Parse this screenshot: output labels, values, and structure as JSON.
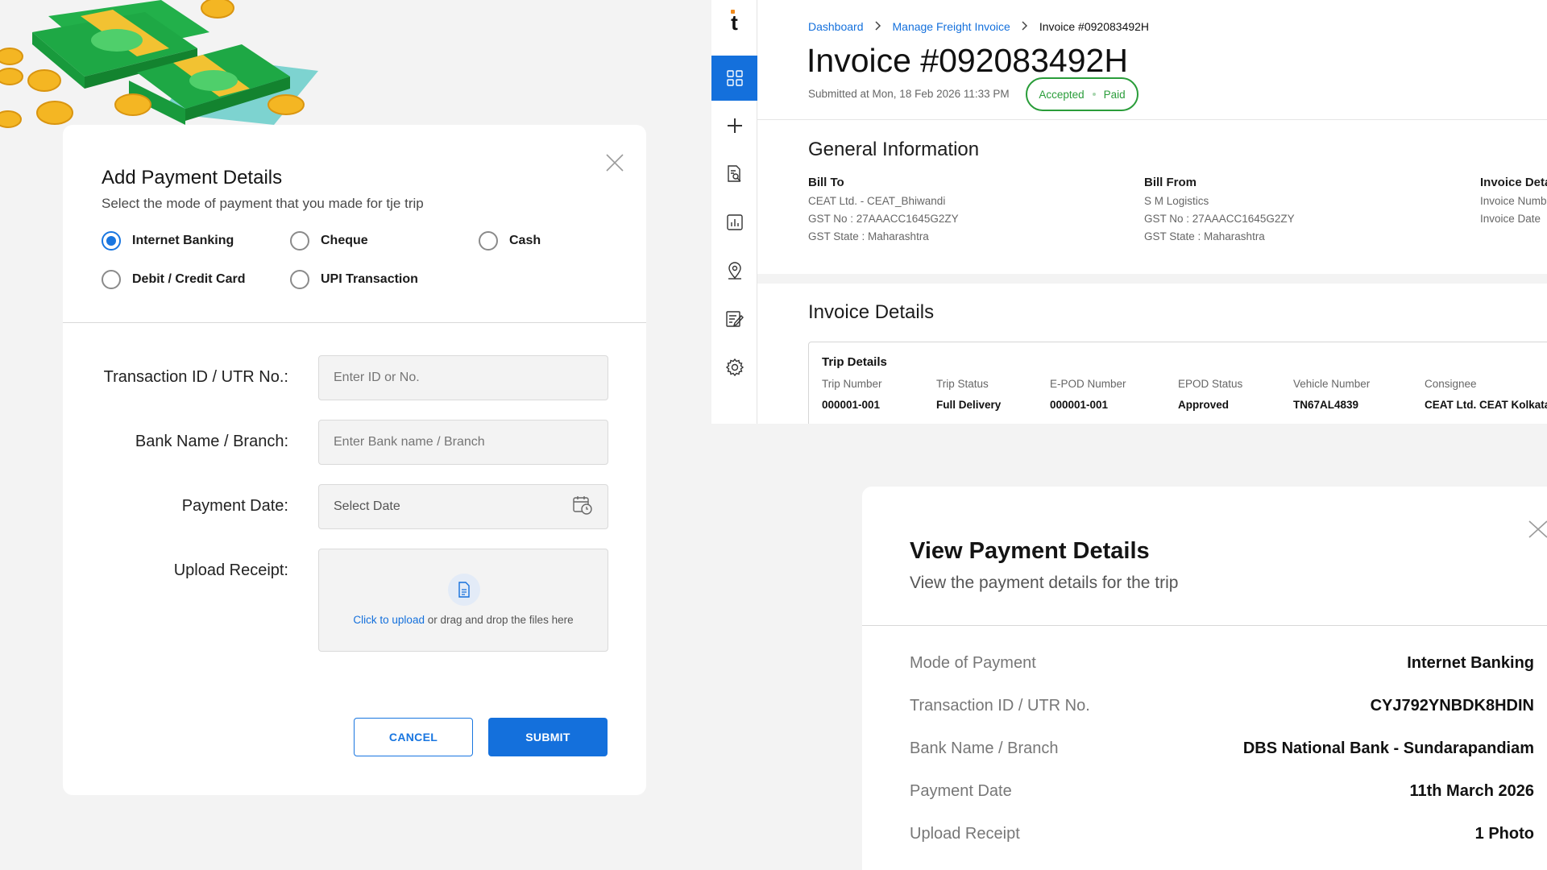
{
  "add_payment": {
    "title": "Add Payment Details",
    "subtitle": "Select the mode of payment that you made for tje trip",
    "modes": [
      "Internet Banking",
      "Cheque",
      "Cash",
      "Debit / Credit Card",
      "UPI Transaction"
    ],
    "selected_mode": "Internet Banking",
    "fields": {
      "transaction_label": "Transaction ID / UTR No.:",
      "transaction_placeholder": "Enter ID or No.",
      "bank_label": "Bank Name / Branch:",
      "bank_placeholder": "Enter Bank name / Branch",
      "date_label": "Payment Date:",
      "date_placeholder": "Select Date",
      "receipt_label": "Upload Receipt:",
      "upload_link": "Click to upload",
      "upload_text": " or drag and drop the files here"
    },
    "cancel_label": "CANCEL",
    "submit_label": "SUBMIT"
  },
  "sidebar": {
    "logo": "t",
    "icons": [
      "grid-icon",
      "plus-icon",
      "document-search-icon",
      "report-chart-icon",
      "location-pin-icon",
      "edit-document-icon",
      "gear-icon"
    ],
    "active_index": 0
  },
  "invoice": {
    "breadcrumb": [
      "Dashboard",
      "Manage Freight Invoice",
      "Invoice #092083492H"
    ],
    "title": "Invoice #092083492H",
    "submitted": "Submitted at Mon, 18 Feb 2026 11:33 PM",
    "status_accepted": "Accepted",
    "status_paid": "Paid",
    "status_color": "#2a9d3a",
    "general_title": "General Information",
    "bill_to": {
      "head": "Bill To",
      "lines": [
        "CEAT Ltd. - CEAT_Bhiwandi",
        "GST No : 27AAACC1645G2ZY",
        "GST State : Maharashtra"
      ]
    },
    "bill_from": {
      "head": "Bill From",
      "lines": [
        "S M Logistics",
        "GST No : 27AAACC1645G2ZY",
        "GST State : Maharashtra"
      ]
    },
    "invoice_details_col": {
      "head": "Invoice Deta",
      "lines": [
        "Invoice Numb",
        "Invoice Date"
      ]
    },
    "details_title": "Invoice Details",
    "trip": {
      "title": "Trip Details",
      "headers": [
        "Trip Number",
        "Trip Status",
        "E-POD Number",
        "EPOD Status",
        "Vehicle Number",
        "Consignee"
      ],
      "values": [
        "000001-001",
        "Full Delivery",
        "000001-001",
        "Approved",
        "TN67AL4839",
        "CEAT Ltd. CEAT Kolkata"
      ]
    }
  },
  "view_payment": {
    "title": "View Payment Details",
    "subtitle": "View the payment details for the trip",
    "rows": [
      {
        "label": "Mode of Payment",
        "value": "Internet Banking"
      },
      {
        "label": "Transaction ID / UTR No.",
        "value": "CYJ792YNBDK8HDIN"
      },
      {
        "label": "Bank Name / Branch",
        "value": "DBS National Bank - Sundarapandiam"
      },
      {
        "label": "Payment Date",
        "value": "11th March 2026"
      },
      {
        "label": "Upload Receipt",
        "value": "1 Photo"
      }
    ]
  },
  "colors": {
    "primary": "#1470dc",
    "status_green": "#2a9d3a",
    "background": "#f3f3f3"
  }
}
